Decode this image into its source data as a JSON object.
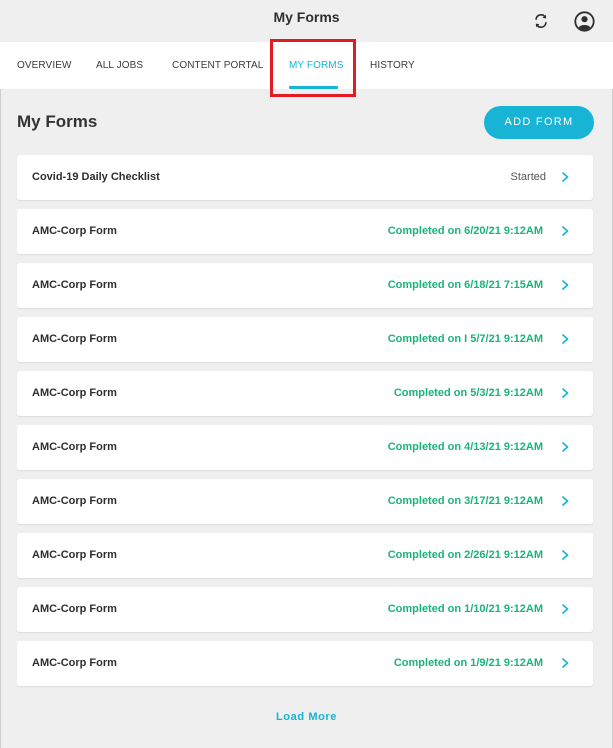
{
  "header": {
    "title": "My Forms",
    "sync_icon": "sync-icon",
    "profile_icon": "user-circle-icon"
  },
  "tabs": [
    {
      "label": "OVERVIEW"
    },
    {
      "label": "ALL JOBS"
    },
    {
      "label": "CONTENT PORTAL"
    },
    {
      "label": "MY FORMS",
      "active": true
    },
    {
      "label": "HISTORY"
    }
  ],
  "section": {
    "title": "My Forms",
    "add_button_label": "ADD FORM"
  },
  "forms": [
    {
      "name": "Covid-19 Daily Checklist",
      "status": "Started"
    },
    {
      "name": "AMC-Corp Form",
      "status": "Completed on 6/20/21 9:12AM"
    },
    {
      "name": "AMC-Corp Form",
      "status": "Completed on 6/18/21 7:15AM"
    },
    {
      "name": "AMC-Corp Form",
      "status": "Completed on I 5/7/21 9:12AM"
    },
    {
      "name": "AMC-Corp Form",
      "status": "Completed on 5/3/21 9:12AM"
    },
    {
      "name": "AMC-Corp Form",
      "status": "Completed on 4/13/21 9:12AM"
    },
    {
      "name": "AMC-Corp Form",
      "status": "Completed on 3/17/21 9:12AM"
    },
    {
      "name": "AMC-Corp Form",
      "status": "Completed on 2/26/21 9:12AM"
    },
    {
      "name": "AMC-Corp Form",
      "status": "Completed on 1/10/21 9:12AM"
    },
    {
      "name": "AMC-Corp Form",
      "status": "Completed on 1/9/21 9:12AM"
    }
  ],
  "footer": {
    "load_more_label": "Load More"
  },
  "colors": {
    "accent": "#17b4d6",
    "completed": "#1bb37a",
    "highlight": "#e31b23",
    "background": "#efefef"
  }
}
